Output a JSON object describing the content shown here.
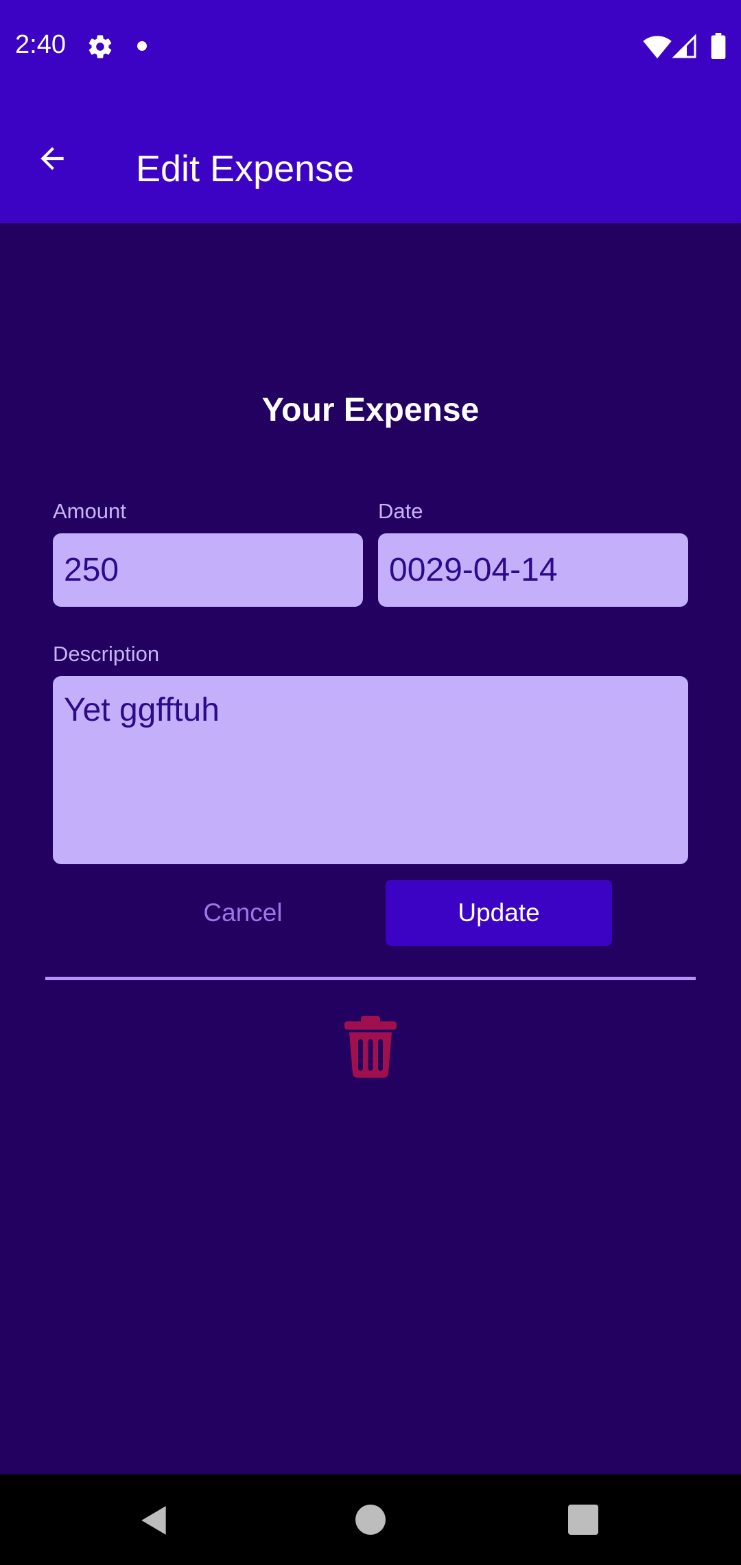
{
  "status_bar": {
    "time": "2:40",
    "icons": [
      "gear-icon",
      "notification-dot-icon",
      "wifi-icon",
      "signal-icon",
      "battery-icon"
    ]
  },
  "app_bar": {
    "title": "Edit Expense",
    "back_icon": "arrow-left-icon"
  },
  "form": {
    "heading": "Your Expense",
    "amount_label": "Amount",
    "amount_value": "250",
    "date_label": "Date",
    "date_value": "0029-04-14",
    "description_label": "Description",
    "description_value": "Yet ggfftuh"
  },
  "actions": {
    "cancel_label": "Cancel",
    "update_label": "Update",
    "delete_icon": "trash-icon"
  },
  "nav_bar": {
    "icons": [
      "back-triangle-icon",
      "home-circle-icon",
      "recents-square-icon"
    ]
  },
  "colors": {
    "app_bar": "#3d03c4",
    "background": "#220160",
    "input_fill": "#c4b0fa",
    "input_text": "#2e0a8a",
    "delete": "#a0104f",
    "divider": "#b393f5"
  }
}
